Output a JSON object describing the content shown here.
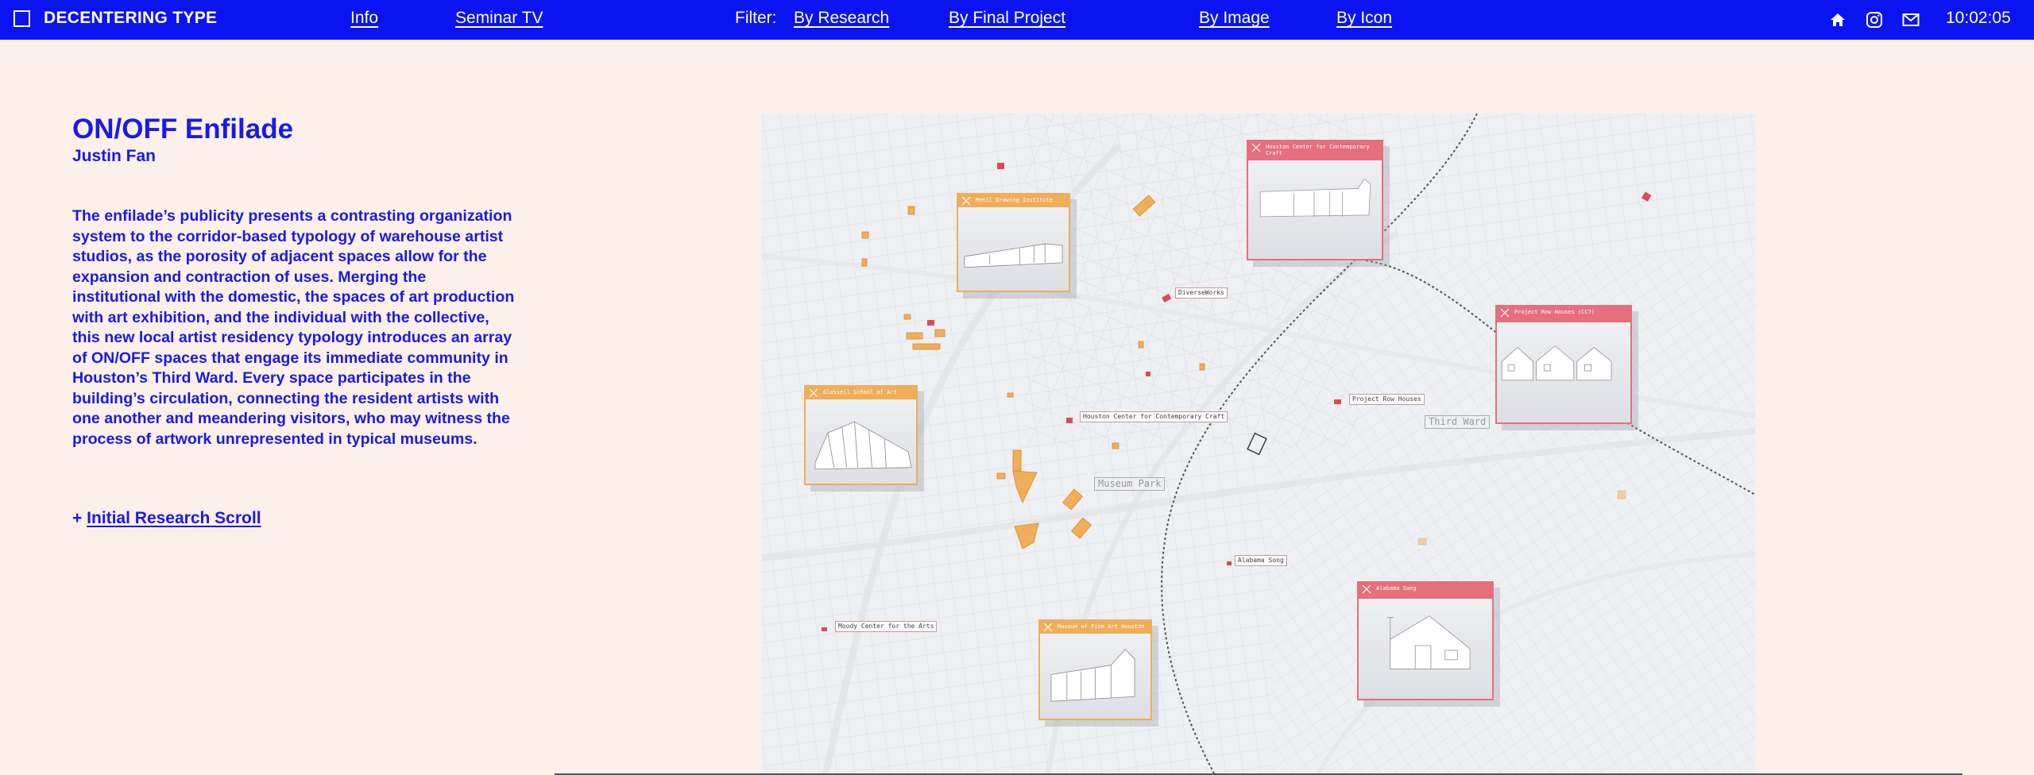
{
  "header": {
    "brand": "DECENTERING TYPE",
    "nav": [
      "Info",
      "Seminar TV"
    ],
    "filter_label": "Filter:",
    "filters": [
      "By Research",
      "By Final Project",
      "By Image",
      "By Icon"
    ],
    "icons": [
      "home-icon",
      "instagram-icon",
      "mail-icon"
    ],
    "clock": "10:02:05",
    "bar_color": "#0a14f0"
  },
  "project": {
    "title": "ON/OFF Enfilade",
    "author": "Justin Fan",
    "description": "The enfilade’s publicity presents a contrasting organization system to the corridor-based typology of warehouse artist studios, as the porosity of adjacent spaces allow for the expansion and contraction of uses. Merging the institutional with the domestic, the spaces of art production with art exhibition, and the individual with the collective, this new local artist residency typology introduces an array of ON/OFF spaces that engage its immediate community in Houston’s Third Ward. Every space participates in the building’s circulation, connecting the resident artists with one another and meandering visitors, who may witness the process of artwork unrepresented in typical museums.",
    "research_prefix": "+ ",
    "research_link": "Initial Research Scroll",
    "text_color": "#1a1ae6"
  },
  "map": {
    "cards": [
      {
        "title": "Menil Drawing Institute",
        "color": "orange"
      },
      {
        "title": "Houston Center for Contemporary Craft",
        "color": "red"
      },
      {
        "title": "Project Row Houses (CC7)",
        "color": "red"
      },
      {
        "title": "Glassell School of Art",
        "color": "orange"
      },
      {
        "title": "Alabama Song",
        "color": "red"
      },
      {
        "title": "Museum of Fine Art Houston",
        "color": "orange"
      }
    ],
    "labels": [
      "DiverseWorks",
      "Houston Center for Contemporary Craft",
      "Project Row Houses",
      "Alabama Song",
      "Moody Center for the Arts"
    ],
    "areas": [
      "Museum Park",
      "Third Ward"
    ],
    "accent_orange": "#efae5a",
    "accent_red": "#e56f7c"
  }
}
